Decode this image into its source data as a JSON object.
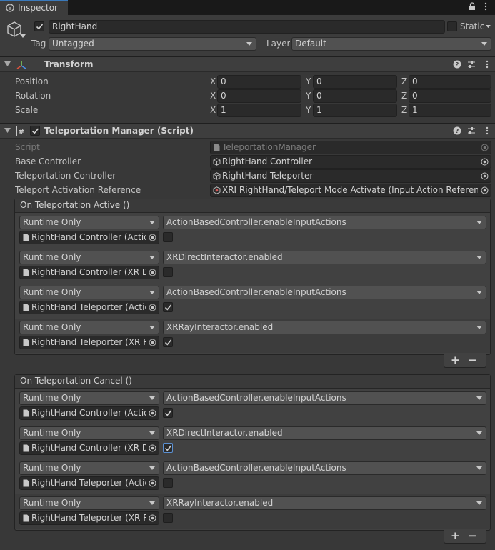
{
  "tab": {
    "label": "Inspector",
    "icon": "info-icon"
  },
  "header": {
    "active": true,
    "name": "RightHand",
    "static_label": "Static",
    "static_checked": false,
    "tag_label": "Tag",
    "tag_value": "Untagged",
    "layer_label": "Layer",
    "layer_value": "Default"
  },
  "transform": {
    "title": "Transform",
    "rows": [
      {
        "label": "Position",
        "x": "0",
        "y": "0",
        "z": "0"
      },
      {
        "label": "Rotation",
        "x": "0",
        "y": "0",
        "z": "0"
      },
      {
        "label": "Scale",
        "x": "1",
        "y": "1",
        "z": "1"
      }
    ],
    "axis_x": "X",
    "axis_y": "Y",
    "axis_z": "Z"
  },
  "teleport": {
    "title": "Teleportation Manager (Script)",
    "enabled": true,
    "script_label": "Script",
    "script_value": "TeleportationManager",
    "base_label": "Base Controller",
    "base_value": "RightHand Controller",
    "tele_label": "Teleportation Controller",
    "tele_value": "RightHand Teleporter",
    "ref_label": "Teleport Activation Reference",
    "ref_value": "XRI RightHand/Teleport Mode Activate (Input Action Reference)"
  },
  "events": [
    {
      "title": "On Teleportation Active ()",
      "items": [
        {
          "mode": "Runtime Only",
          "function": "ActionBasedController.enableInputActions",
          "target": "RightHand Controller (Action",
          "checked": false
        },
        {
          "mode": "Runtime Only",
          "function": "XRDirectInteractor.enabled",
          "target": "RightHand Controller (XR Dire",
          "checked": false
        },
        {
          "mode": "Runtime Only",
          "function": "ActionBasedController.enableInputActions",
          "target": "RightHand Teleporter (Action",
          "checked": true
        },
        {
          "mode": "Runtime Only",
          "function": "XRRayInteractor.enabled",
          "target": "RightHand Teleporter (XR Ra",
          "checked": true
        }
      ]
    },
    {
      "title": "On Teleportation Cancel ()",
      "items": [
        {
          "mode": "Runtime Only",
          "function": "ActionBasedController.enableInputActions",
          "target": "RightHand Controller (Action",
          "checked": true
        },
        {
          "mode": "Runtime Only",
          "function": "XRDirectInteractor.enabled",
          "target": "RightHand Controller (XR Dire",
          "checked": true
        },
        {
          "mode": "Runtime Only",
          "function": "ActionBasedController.enableInputActions",
          "target": "RightHand Teleporter (Action",
          "checked": false
        },
        {
          "mode": "Runtime Only",
          "function": "XRRayInteractor.enabled",
          "target": "RightHand Teleporter (XR Ra",
          "checked": false
        }
      ]
    }
  ],
  "plus_label": "+",
  "minus_label": "−",
  "colors": {
    "accent": "#3a79bb",
    "background": "#383838",
    "field": "#2a2a2a"
  }
}
